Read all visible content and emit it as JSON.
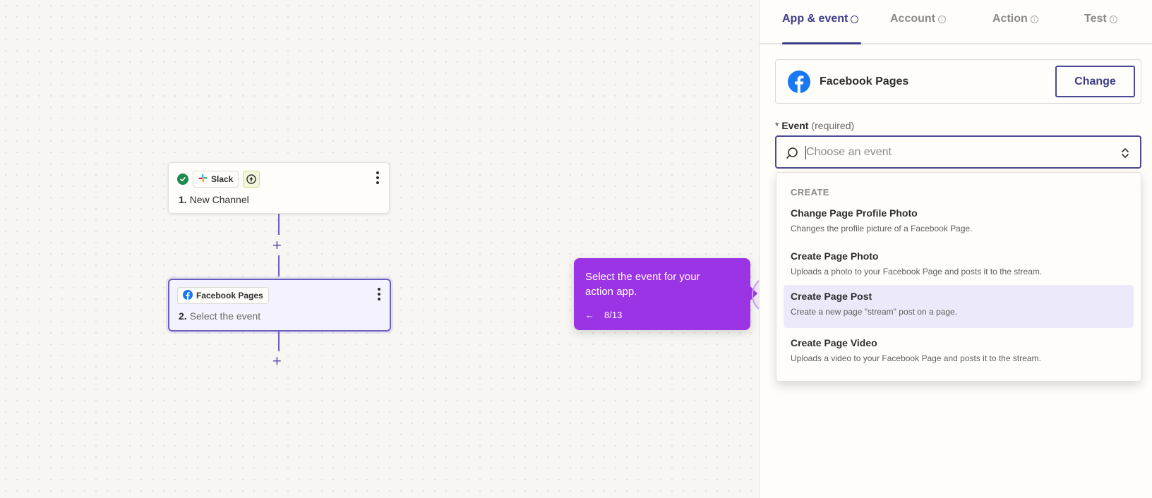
{
  "workflow": {
    "step1": {
      "app_name": "Slack",
      "number": "1.",
      "title": "New Channel"
    },
    "step2": {
      "app_name": "Facebook Pages",
      "number": "2.",
      "title": "Select the event"
    },
    "add_symbol": "+"
  },
  "tooltip": {
    "text": "Select the event for your action app.",
    "back_arrow": "←",
    "progress": "8/13"
  },
  "panel": {
    "tabs": [
      {
        "label": "App & event",
        "active": true
      },
      {
        "label": "Account",
        "active": false
      },
      {
        "label": "Action",
        "active": false
      },
      {
        "label": "Test",
        "active": false
      }
    ],
    "selected_app": {
      "name": "Facebook Pages",
      "change_label": "Change"
    },
    "event_field": {
      "required_mark": "*",
      "label": "Event",
      "required_text": "(required)",
      "placeholder": "Choose an event",
      "value": ""
    },
    "dropdown": {
      "group_label": "CREATE",
      "items": [
        {
          "title": "Change Page Profile Photo",
          "description": "Changes the profile picture of a Facebook Page.",
          "highlighted": false
        },
        {
          "title": "Create Page Photo",
          "description": "Uploads a photo to your Facebook Page and posts it to the stream.",
          "highlighted": false
        },
        {
          "title": "Create Page Post",
          "description": "Create a new page \"stream\" post on a page.",
          "highlighted": true
        },
        {
          "title": "Create Page Video",
          "description": "Uploads a video to your Facebook Page and posts it to the stream.",
          "highlighted": false
        }
      ]
    }
  },
  "colors": {
    "accent": "#3d3d8a",
    "tooltip": "#9b34e4",
    "facebook": "#1877f2",
    "success": "#1d8a4c"
  },
  "icons": [
    "check-circle-icon",
    "slack-icon",
    "trigger-icon",
    "kebab-menu-icon",
    "facebook-icon",
    "search-icon",
    "chevron-updown-icon",
    "arrow-left-icon",
    "info-icon"
  ]
}
